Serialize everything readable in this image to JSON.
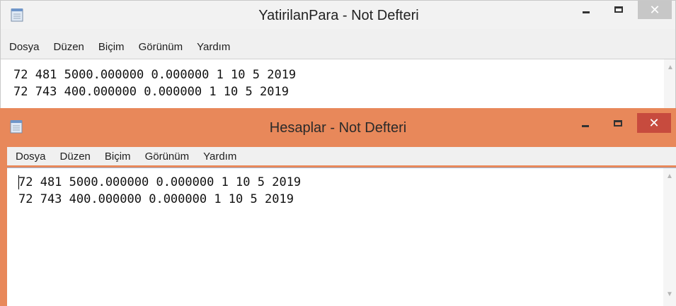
{
  "back_window": {
    "title": "YatirilanPara - Not Defteri",
    "menu": [
      "Dosya",
      "Düzen",
      "Biçim",
      "Görünüm",
      "Yardım"
    ],
    "lines": [
      "72 481 5000.000000 0.000000 1 10 5 2019",
      "72 743 400.000000 0.000000 1 10 5 2019"
    ],
    "close_glyph": "✕"
  },
  "front_window": {
    "title": "Hesaplar - Not Defteri",
    "menu": [
      "Dosya",
      "Düzen",
      "Biçim",
      "Görünüm",
      "Yardım"
    ],
    "lines": [
      "72 481 5000.000000 0.000000 1 10 5 2019",
      "72 743 400.000000 0.000000 1 10 5 2019"
    ],
    "close_glyph": "✕"
  },
  "colors": {
    "active_titlebar": "#e8885a",
    "close_active": "#c74b3e",
    "inactive_titlebar": "#f2f2f2"
  },
  "icons": [
    "notepad-icon",
    "minimize-icon",
    "maximize-icon",
    "close-icon",
    "scroll-up-icon",
    "scroll-down-icon"
  ]
}
